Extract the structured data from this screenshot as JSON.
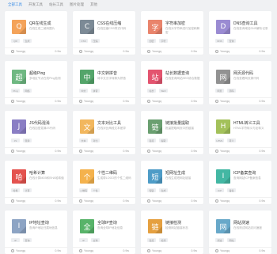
{
  "filters": [
    {
      "label": "全部工具",
      "active": true
    },
    {
      "label": "开发工具",
      "active": false
    },
    {
      "label": "站长工具",
      "active": false
    },
    {
      "label": "图片处理",
      "active": false
    },
    {
      "label": "其他",
      "active": false
    }
  ],
  "cards": [
    {
      "glyph": "Q",
      "color": "#f4a35a",
      "title": "QR在线生成",
      "desc": "在线生成二维码图片",
      "tags": [
        "QR",
        "生成"
      ],
      "author": "Youngq",
      "views": "0.9w"
    },
    {
      "glyph": "C",
      "color": "#7c8a96",
      "title": "CSS在线压缩",
      "desc": "在线压缩CSS样式代码",
      "tags": [
        "CSS",
        "压缩"
      ],
      "author": "Youngq",
      "views": "0.9w"
    },
    {
      "glyph": "字",
      "color": "#e9846c",
      "title": "字符串加密",
      "desc": "在线对字符串进行加密和解密",
      "tags": [
        "加密",
        "字符"
      ],
      "author": "Youngq",
      "views": "0.9w"
    },
    {
      "glyph": "D",
      "color": "#9a8bd2",
      "title": "DNS查询工具",
      "desc": "在线查询域名DNS解析记录",
      "tags": [
        "DNS",
        "查询"
      ],
      "author": "Youngq",
      "views": "0.9w"
    },
    {
      "glyph": "超",
      "color": "#6fb882",
      "title": "超级Ping",
      "desc": "多地区节点在线Ping检测",
      "tags": [
        "Ping",
        "网络"
      ],
      "author": "Youngq",
      "views": "0.9w"
    },
    {
      "glyph": "中",
      "color": "#54a56a",
      "title": "中文转拼音",
      "desc": "将中文汉字转换为拼音",
      "tags": [
        "中文",
        "拼音"
      ],
      "author": "Youngq",
      "views": "0.9w"
    },
    {
      "glyph": "站",
      "color": "#e3546f",
      "title": "站长数据查询",
      "desc": "在线查询网站SEO综合数据",
      "tags": [
        "站长",
        "SEO"
      ],
      "author": "Youngq",
      "views": "0.9w"
    },
    {
      "glyph": "网",
      "color": "#929292",
      "title": "网页源代码",
      "desc": "在线查看网页源代码",
      "tags": [
        "网页",
        "源码"
      ],
      "author": "Youngq",
      "views": "0.9w"
    },
    {
      "glyph": "J",
      "color": "#8a7ec4",
      "title": "JS代码混淆",
      "desc": "在线加密混淆JS代码",
      "tags": [
        "JS",
        "混淆"
      ],
      "author": "Youngq",
      "views": "0.9w"
    },
    {
      "glyph": "文",
      "color": "#f2b75e",
      "title": "文本对比工具",
      "desc": "在线对比两段文本差异",
      "tags": [
        "文本",
        "对比"
      ],
      "author": "Youngq",
      "views": "0.9w"
    },
    {
      "glyph": "链",
      "color": "#6a9f70",
      "title": "链接批量提取",
      "desc": "批量提取网页中的链接",
      "tags": [
        "链接",
        "提取"
      ],
      "author": "Youngq",
      "views": "0.9w"
    },
    {
      "glyph": "H",
      "color": "#a3c15a",
      "title": "HTML转义工具",
      "desc": "HTML字符转义与反转义",
      "tags": [
        "HTML",
        "转义"
      ],
      "author": "Youngq",
      "views": "0.9w"
    },
    {
      "glyph": "哈",
      "color": "#e4534f",
      "title": "哈希计算",
      "desc": "在线计算MD5和SHA哈希值",
      "tags": [
        "哈希",
        "计算"
      ],
      "author": "Youngq",
      "views": "0.9w"
    },
    {
      "glyph": "个",
      "color": "#f4b24d",
      "title": "个性二维码",
      "desc": "生成带LOGO的个性二维码",
      "tags": [
        "二维码",
        "个性"
      ],
      "author": "Youngq",
      "views": "0.9w"
    },
    {
      "glyph": "短",
      "color": "#4e9cc7",
      "title": "短网址生成",
      "desc": "在线生成短网址链接",
      "tags": [
        "短链",
        "生成"
      ],
      "author": "Youngq",
      "views": "0.9w"
    },
    {
      "glyph": "I",
      "color": "#43b7a3",
      "title": "ICP备案查询",
      "desc": "查询网站ICP备案信息",
      "tags": [
        "ICP",
        "备案"
      ],
      "author": "Youngq",
      "views": "0.9w"
    },
    {
      "glyph": "I",
      "color": "#8da4c4",
      "title": "IP地址查询",
      "desc": "查询IP地址归属地信息",
      "tags": [
        "IP",
        "查询"
      ],
      "author": "Youngq",
      "views": "0.9w"
    },
    {
      "glyph": "全",
      "color": "#58b369",
      "title": "全球IP查询",
      "desc": "查询全球IP地址信息",
      "tags": [
        "IP",
        "全球"
      ],
      "author": "Youngq",
      "views": "0.9w"
    },
    {
      "glyph": "链",
      "color": "#e5a040",
      "title": "链接检测",
      "desc": "检测网站链接状态",
      "tags": [
        "链接",
        "检测"
      ],
      "author": "Youngq",
      "views": "0.9w"
    },
    {
      "glyph": "网",
      "color": "#68a8c9",
      "title": "网站测速",
      "desc": "在线测试网站访问速度",
      "tags": [
        "测速",
        "网站"
      ],
      "author": "Youngq",
      "views": "0.9w"
    }
  ]
}
